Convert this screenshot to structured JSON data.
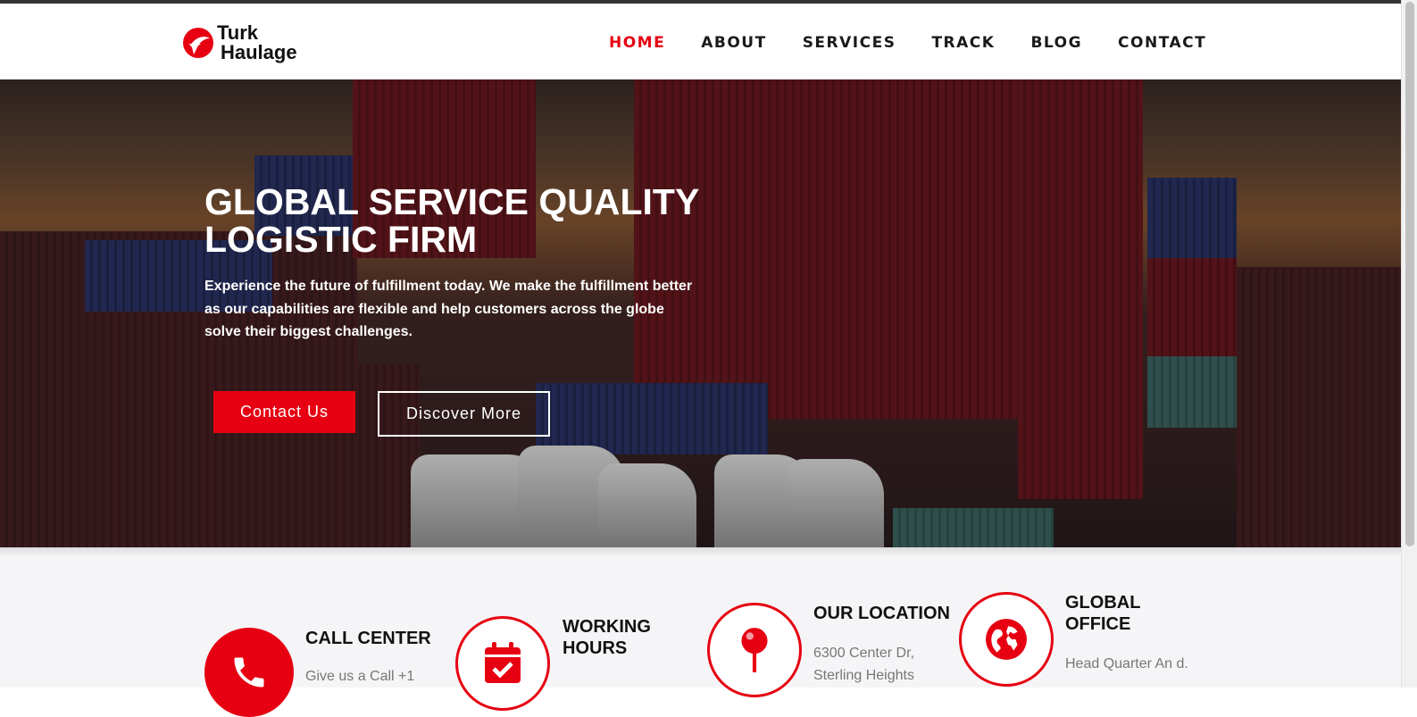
{
  "brand": {
    "line1": "Turk",
    "line2": "Haulage",
    "accent_color": "#e60012"
  },
  "nav": {
    "items": [
      {
        "label": "HOME",
        "active": true
      },
      {
        "label": "ABOUT",
        "active": false
      },
      {
        "label": "SERVICES",
        "active": false
      },
      {
        "label": "TRACK",
        "active": false
      },
      {
        "label": "BLOG",
        "active": false
      },
      {
        "label": "CONTACT",
        "active": false
      }
    ]
  },
  "hero": {
    "title": "GLOBAL SERVICE QUALITY LOGISTIC FIRM",
    "text": "Experience the future of fulfillment today. We make the fulfillment better as our capabilities are flexible and help customers across the globe solve their biggest challenges.",
    "primary_button": "Contact Us",
    "secondary_button": "Discover More",
    "background": "shipping containers and trucks at sunset"
  },
  "info_cards": [
    {
      "title": "CALL CENTER",
      "text": "Give us a Call +1",
      "icon": "phone-icon"
    },
    {
      "title": "WORKING HOURS",
      "text": "",
      "icon": "calendar-check-icon"
    },
    {
      "title": "OUR LOCATION",
      "text": "6300 Center Dr, Sterling Heights",
      "icon": "map-pin-icon"
    },
    {
      "title": "GLOBAL OFFICE",
      "text": "Head Quarter An d.",
      "icon": "globe-icon"
    }
  ]
}
